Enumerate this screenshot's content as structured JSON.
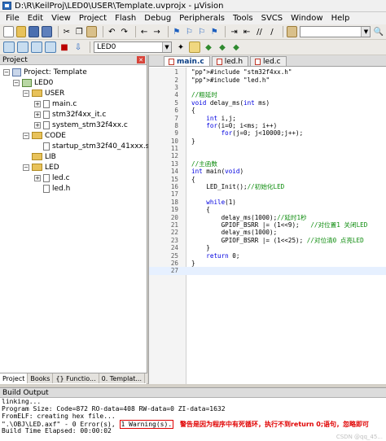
{
  "window": {
    "title": "D:\\R\\KeilProj\\LED0\\USER\\Template.uvprojx - µVision"
  },
  "menu": [
    "File",
    "Edit",
    "View",
    "Project",
    "Flash",
    "Debug",
    "Peripherals",
    "Tools",
    "SVCS",
    "Window",
    "Help"
  ],
  "toolbar": {
    "target": "LED0"
  },
  "project": {
    "title": "Project",
    "root": "Project: Template",
    "target": "LED0",
    "groups": [
      {
        "name": "USER",
        "files": [
          "main.c",
          "stm32f4xx_it.c",
          "system_stm32f4xx.c"
        ]
      },
      {
        "name": "CODE",
        "files": [
          "startup_stm32f40_41xxx.s"
        ]
      },
      {
        "name": "LIB",
        "files": []
      },
      {
        "name": "LED",
        "files": [
          "led.c",
          "led.h"
        ]
      }
    ],
    "bottom_tabs": [
      "Project",
      "Books",
      "{} Functio...",
      "0. Templat..."
    ]
  },
  "editor": {
    "tabs": [
      "main.c",
      "led.h",
      "led.c"
    ],
    "active_tab": "main.c",
    "current_line": 27,
    "code": [
      "#include \"stm32f4xx.h\"",
      "#include \"led.h\"",
      "",
      "//粗延时",
      "void delay_ms(int ms)",
      "{",
      "    int i,j;",
      "    for(i=0; i<ms; i++)",
      "        for(j=0; j<10000;j++);",
      "}",
      "",
      "",
      "//主函数",
      "int main(void)",
      "{",
      "    LED_Init();//初始化LED",
      "",
      "    while(1)",
      "    {",
      "        delay_ms(1000);//延时1秒",
      "        GPIOF_BSRR |= (1<<9);   //对位置1 关闭LED",
      "        delay_ms(1000);",
      "        GPIOF_BSRR |= (1<<25); //对位清0 点亮LED",
      "    }",
      "    return 0;",
      "}",
      ""
    ]
  },
  "build_output": {
    "title": "Build Output",
    "lines": [
      "linking...",
      "Program Size: Code=872 RO-data=408 RW-data=0 ZI-data=1632",
      "FromELF: creating hex file...",
      "\".\\OBJ\\LED.axf\" - 0 Error(s),",
      "Build Time Elapsed:  00:00:02"
    ],
    "warning": "1 Warning(s).",
    "note": "警告是因为程序中有死循环，执行不到return 0;语句，忽略即可",
    "watermark": "CSDN @qq_45..."
  }
}
